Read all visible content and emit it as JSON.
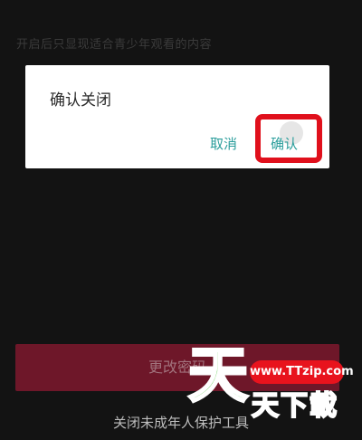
{
  "background": {
    "hint_text": "开启后只显现适合青少年观看的内容"
  },
  "dialog": {
    "title": "确认关闭",
    "cancel_label": "取消",
    "confirm_label": "确认"
  },
  "page": {
    "primary_button_label": "更改密码",
    "secondary_link_label": "关闭未成年人保护工具"
  },
  "watermark": {
    "url": "www.TTzip.com",
    "big_char": "天",
    "brand": "天下載"
  },
  "colors": {
    "background": "#131313",
    "dialog_background": "#ffffff",
    "action_text": "#2a9d9b",
    "primary_button": "#6e1729",
    "highlight": "#e0101c",
    "watermark_green": "#3cc227",
    "watermark_red": "#e8131d"
  }
}
